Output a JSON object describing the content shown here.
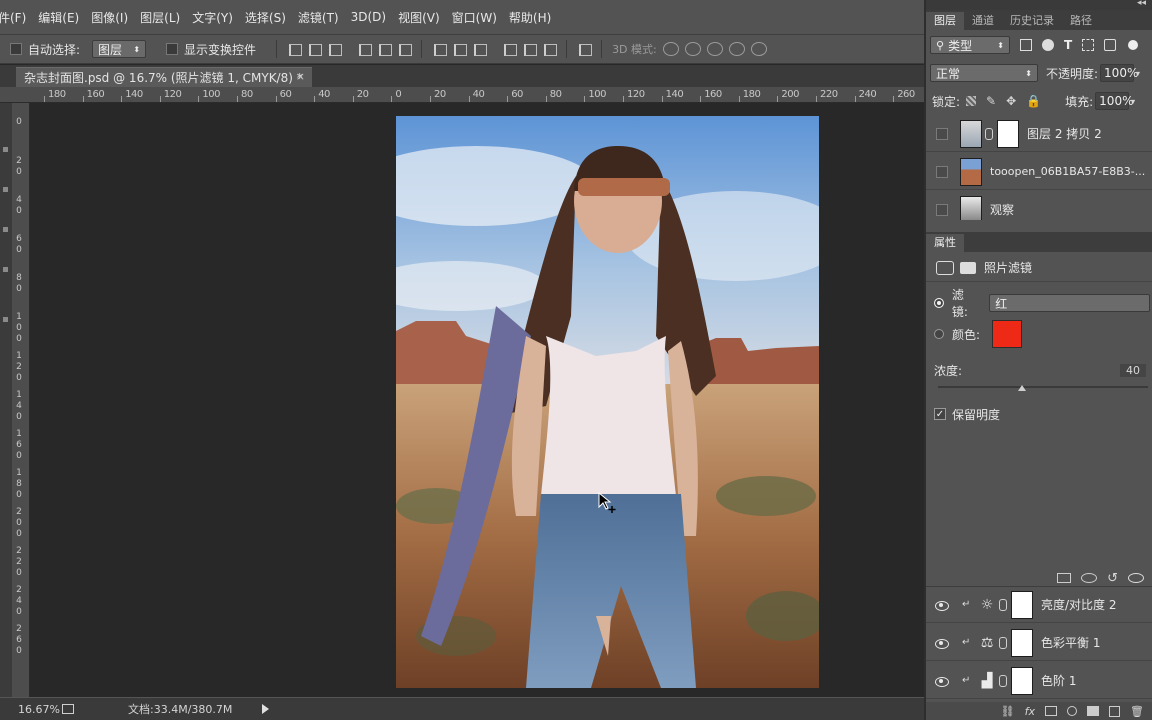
{
  "menu": {
    "items": [
      "件(F)",
      "编辑(E)",
      "图像(I)",
      "图层(L)",
      "文字(Y)",
      "选择(S)",
      "滤镜(T)",
      "3D(D)",
      "视图(V)",
      "窗口(W)",
      "帮助(H)"
    ]
  },
  "options": {
    "auto_select_label": "自动选择:",
    "auto_select_value": "图层",
    "show_transform_label": "显示变换控件",
    "mode_3d_label": "3D 模式:"
  },
  "document": {
    "tab_title": "杂志封面图.psd @ 16.7% (照片滤镜 1, CMYK/8) *",
    "close_glyph": "×"
  },
  "ruler_top": [
    "180",
    "160",
    "140",
    "120",
    "100",
    "80",
    "60",
    "40",
    "20",
    "0",
    "20",
    "40",
    "60",
    "80",
    "100",
    "120",
    "140",
    "160",
    "180",
    "200",
    "220",
    "240",
    "260"
  ],
  "ruler_left": [
    "0",
    "2 0",
    "4 0",
    "6 0",
    "8 0",
    "1 0 0",
    "1 2 0",
    "1 4 0",
    "1 6 0",
    "1 8 0",
    "2 0 0",
    "2 2 0",
    "2 4 0",
    "2 6 0"
  ],
  "status": {
    "zoom": "16.67%",
    "doc_info": "文档:33.4M/380.7M"
  },
  "layers_panel": {
    "tabs": [
      "图层",
      "通道",
      "历史记录",
      "路径"
    ],
    "filter_type": "类型",
    "blend_mode": "正常",
    "opacity_label": "不透明度:",
    "opacity_value": "100%",
    "lock_label": "锁定:",
    "fill_label": "填充:",
    "fill_value": "100%",
    "top_layers": [
      {
        "name": "图层 2 拷贝 2",
        "visible": false
      },
      {
        "name": "tooopen_06B1BA57-E8B3-...",
        "visible": false
      },
      {
        "name": "观察",
        "visible": false
      }
    ],
    "bottom_layers": [
      {
        "name": "亮度/对比度 2",
        "icon": "brightness-icon"
      },
      {
        "name": "色彩平衡 1",
        "icon": "balance-icon"
      },
      {
        "name": "色阶 1",
        "icon": "levels-icon"
      }
    ]
  },
  "properties_panel": {
    "tab": "属性",
    "title": "照片滤镜",
    "filter_label": "滤镜:",
    "filter_value": "红",
    "color_label": "颜色:",
    "color_value": "#ee2a16",
    "density_label": "浓度:",
    "density_value": "40",
    "density_percent": 40,
    "preserve_label": "保留明度",
    "preserve_checked": true
  }
}
